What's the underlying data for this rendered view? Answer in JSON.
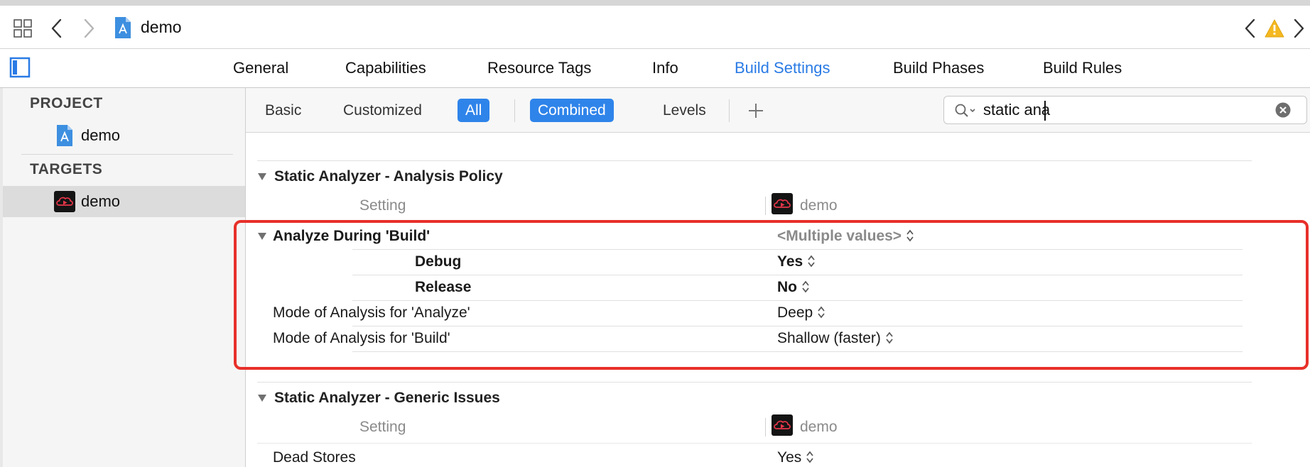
{
  "jumpbar": {
    "breadcrumb": "demo",
    "icons": [
      "related-items-icon",
      "back-icon",
      "forward-icon",
      "project-icon",
      "previous-issue-icon",
      "warning-icon",
      "next-issue-icon"
    ]
  },
  "tabs": [
    {
      "label": "General",
      "active": false
    },
    {
      "label": "Capabilities",
      "active": false
    },
    {
      "label": "Resource Tags",
      "active": false
    },
    {
      "label": "Info",
      "active": false
    },
    {
      "label": "Build Settings",
      "active": true
    },
    {
      "label": "Build Phases",
      "active": false
    },
    {
      "label": "Build Rules",
      "active": false
    }
  ],
  "sidebar": {
    "project_heading": "PROJECT",
    "project_item": "demo",
    "targets_heading": "TARGETS",
    "target_item": "demo"
  },
  "filter": {
    "basic": "Basic",
    "customized": "Customized",
    "all": "All",
    "combined": "Combined",
    "levels": "Levels",
    "search_value": "static ana"
  },
  "sections": [
    {
      "title": "Static Analyzer - Analysis Policy",
      "column_setting": "Setting",
      "column_target": "demo",
      "rows": [
        {
          "label": "Analyze During 'Build'",
          "value": "<Multiple values>",
          "bold": true,
          "multi": true
        },
        {
          "label": "Debug",
          "value": "Yes",
          "bold": true
        },
        {
          "label": "Release",
          "value": "No",
          "bold": true
        },
        {
          "label": "Mode of Analysis for 'Analyze'",
          "value": "Deep",
          "bold": false
        },
        {
          "label": "Mode of Analysis for 'Build'",
          "value": "Shallow (faster)",
          "bold": false
        }
      ]
    },
    {
      "title": "Static Analyzer - Generic Issues",
      "column_setting": "Setting",
      "column_target": "demo",
      "rows": [
        {
          "label": "Dead Stores",
          "value": "Yes",
          "bold": false
        }
      ]
    }
  ],
  "colors": {
    "accent": "#2a7be5",
    "selected_button": "#2f84ea",
    "highlight": "#e8302a",
    "warning": "#f5b820"
  }
}
